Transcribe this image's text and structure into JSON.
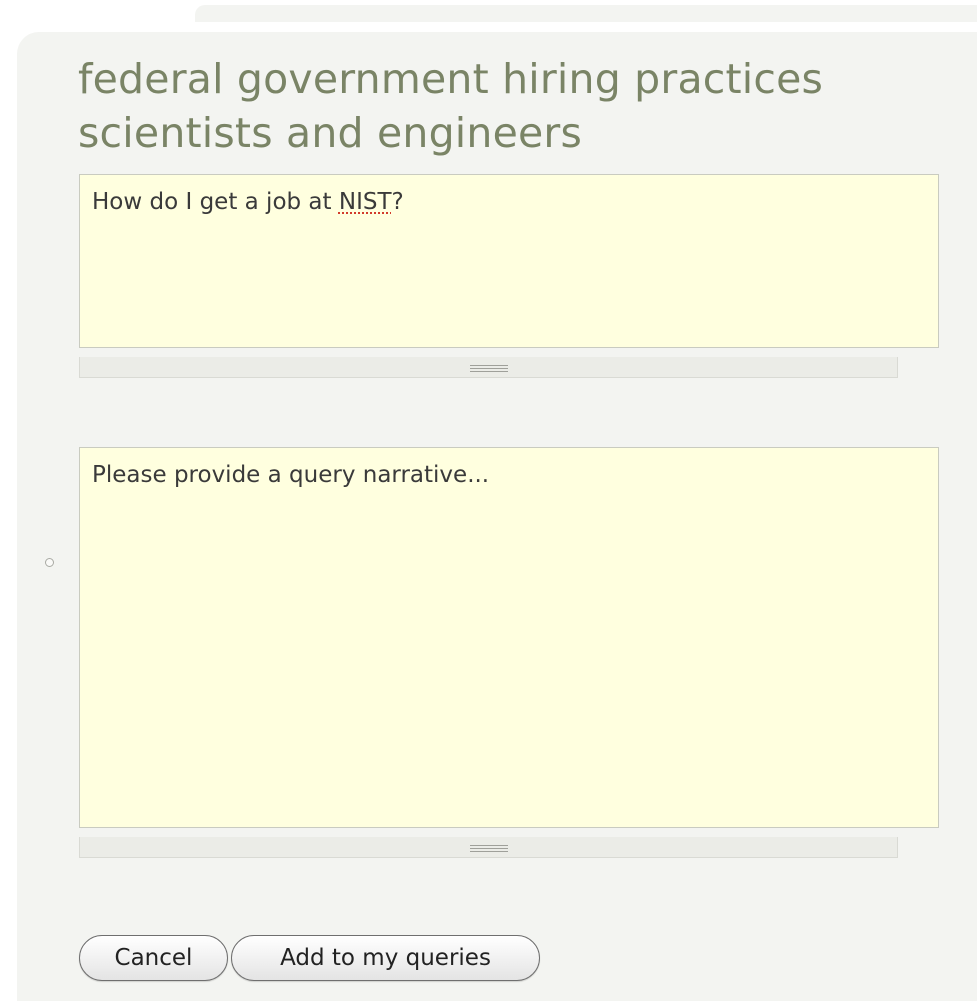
{
  "query": {
    "title_line1": "federal government hiring practices",
    "title_line2": "scientists and engineers",
    "question_prefix": "How do I get a job at ",
    "question_flagged_word": "NIST",
    "question_suffix": "?",
    "narrative_placeholder": "Please provide a query narrative..."
  },
  "actions": {
    "cancel_label": "Cancel",
    "add_label": "Add to my queries"
  },
  "colors": {
    "title": "#7a8466",
    "panel_background": "#f3f4f1",
    "textbox_background": "#ffffdf",
    "spellcheck_underline": "#d23b2b"
  },
  "icons": {
    "textbox_resize": "resize-grip-icon",
    "option_marker": "radio-circle-icon"
  }
}
